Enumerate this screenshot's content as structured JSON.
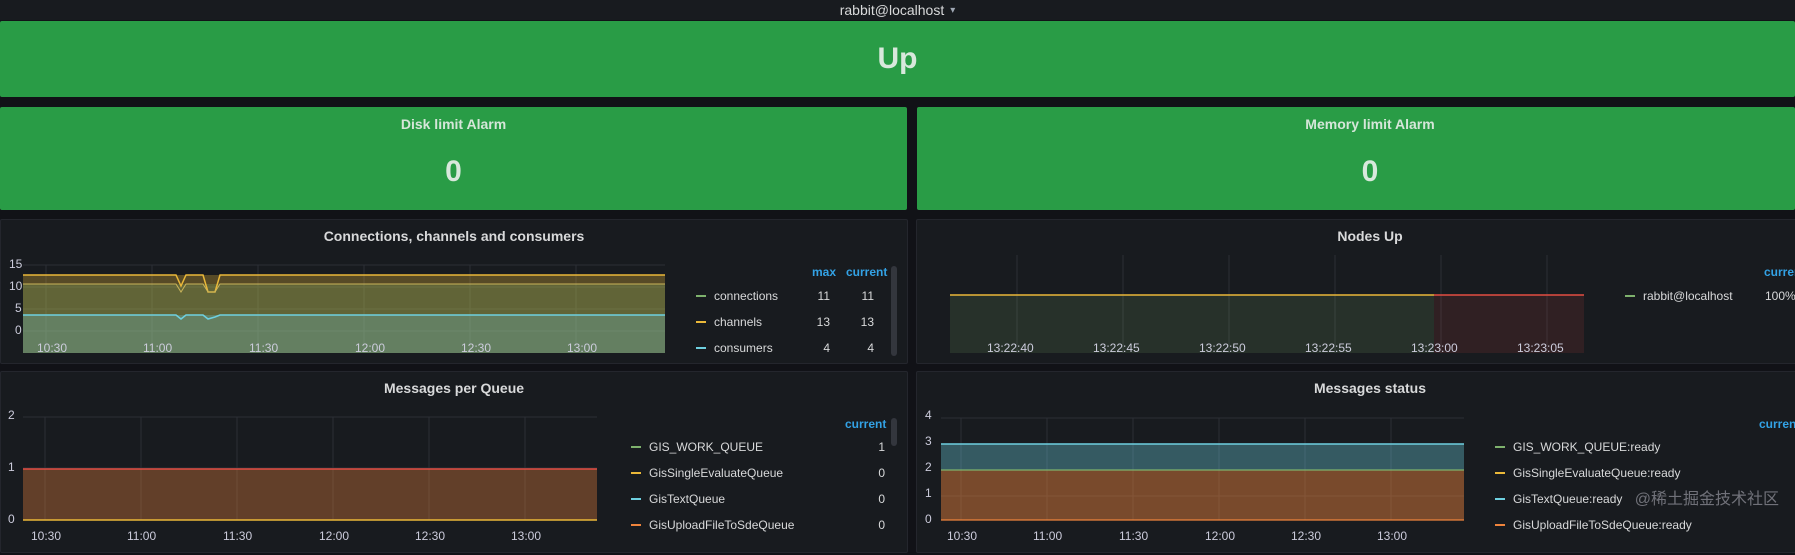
{
  "topbar": {
    "instance": "rabbit@localhost"
  },
  "status": {
    "value": "Up",
    "color": "#299c46"
  },
  "disk_alarm": {
    "title": "Disk limit Alarm",
    "value": "0"
  },
  "memory_alarm": {
    "title": "Memory limit Alarm",
    "value": "0"
  },
  "connections_panel": {
    "title": "Connections, channels and consumers",
    "legend_headers": {
      "max": "max",
      "current": "current"
    },
    "legend": [
      {
        "name": "connections",
        "max": "11",
        "current": "11",
        "color": "#7eb26d"
      },
      {
        "name": "channels",
        "max": "13",
        "current": "13",
        "color": "#eab839"
      },
      {
        "name": "consumers",
        "max": "4",
        "current": "4",
        "color": "#6ed0e0"
      }
    ]
  },
  "nodes_panel": {
    "title": "Nodes Up",
    "legend_headers": {
      "current": "current"
    },
    "legend": [
      {
        "name": "rabbit@localhost",
        "current": "100%",
        "color": "#7eb26d"
      }
    ]
  },
  "queue_panel": {
    "title": "Messages per Queue",
    "legend_headers": {
      "current": "current"
    },
    "legend": [
      {
        "name": "GIS_WORK_QUEUE",
        "current": "1",
        "color": "#7eb26d"
      },
      {
        "name": "GisSingleEvaluateQueue",
        "current": "0",
        "color": "#eab839"
      },
      {
        "name": "GisTextQueue",
        "current": "0",
        "color": "#6ed0e0"
      },
      {
        "name": "GisUploadFileToSdeQueue",
        "current": "0",
        "color": "#ef843c"
      }
    ]
  },
  "status_panel": {
    "title": "Messages status",
    "legend_headers": {
      "current": "current"
    },
    "legend": [
      {
        "name": "GIS_WORK_QUEUE:ready",
        "current": "",
        "color": "#7eb26d"
      },
      {
        "name": "GisSingleEvaluateQueue:ready",
        "current": "",
        "color": "#eab839"
      },
      {
        "name": "GisTextQueue:ready",
        "current": "",
        "color": "#6ed0e0"
      },
      {
        "name": "GisUploadFileToSdeQueue:ready",
        "current": "",
        "color": "#ef843c"
      }
    ]
  },
  "watermark": "@稀土掘金技术社区",
  "chart_data": [
    {
      "type": "line",
      "title": "Connections, channels and consumers",
      "x": [
        "10:30",
        "11:00",
        "11:30",
        "12:00",
        "12:30",
        "13:00"
      ],
      "yticks": [
        "0",
        "5",
        "10",
        "15"
      ],
      "ylim": [
        0,
        15
      ],
      "series": [
        {
          "name": "connections",
          "values": [
            11,
            11,
            11,
            11,
            11,
            11
          ]
        },
        {
          "name": "channels",
          "values": [
            13,
            13,
            13,
            13,
            13,
            13
          ]
        },
        {
          "name": "consumers",
          "values": [
            4,
            4,
            4,
            4,
            4,
            4
          ]
        }
      ]
    },
    {
      "type": "area",
      "title": "Nodes Up",
      "x": [
        "13:22:40",
        "13:22:45",
        "13:22:50",
        "13:22:55",
        "13:23:00",
        "13:23:05"
      ],
      "series": [
        {
          "name": "rabbit@localhost",
          "values": [
            1,
            1,
            1,
            1,
            1,
            1
          ]
        }
      ]
    },
    {
      "type": "area",
      "title": "Messages per Queue",
      "x": [
        "10:30",
        "11:00",
        "11:30",
        "12:00",
        "12:30",
        "13:00"
      ],
      "yticks": [
        "0",
        "1",
        "2"
      ],
      "ylim": [
        0,
        2
      ],
      "series": [
        {
          "name": "GIS_WORK_QUEUE",
          "values": [
            1,
            1,
            1,
            1,
            1,
            1
          ]
        },
        {
          "name": "GisSingleEvaluateQueue",
          "values": [
            0,
            0,
            0,
            0,
            0,
            0
          ]
        },
        {
          "name": "GisTextQueue",
          "values": [
            0,
            0,
            0,
            0,
            0,
            0
          ]
        },
        {
          "name": "GisUploadFileToSdeQueue",
          "values": [
            0,
            0,
            0,
            0,
            0,
            0
          ]
        }
      ]
    },
    {
      "type": "area",
      "title": "Messages status",
      "x": [
        "10:30",
        "11:00",
        "11:30",
        "12:00",
        "12:30",
        "13:00"
      ],
      "yticks": [
        "0",
        "1",
        "2",
        "3",
        "4"
      ],
      "ylim": [
        0,
        4
      ],
      "series": [
        {
          "name": "GIS_WORK_QUEUE:ready",
          "values": [
            3,
            3,
            3,
            3,
            3,
            3
          ]
        },
        {
          "name": "GisSingleEvaluateQueue:ready",
          "values": [
            2,
            2,
            2,
            2,
            2,
            2
          ]
        },
        {
          "name": "GisTextQueue:ready",
          "values": [
            3,
            3,
            3,
            3,
            3,
            3
          ]
        },
        {
          "name": "GisUploadFileToSdeQueue:ready",
          "values": [
            0,
            0,
            0,
            0,
            0,
            0
          ]
        }
      ]
    }
  ]
}
